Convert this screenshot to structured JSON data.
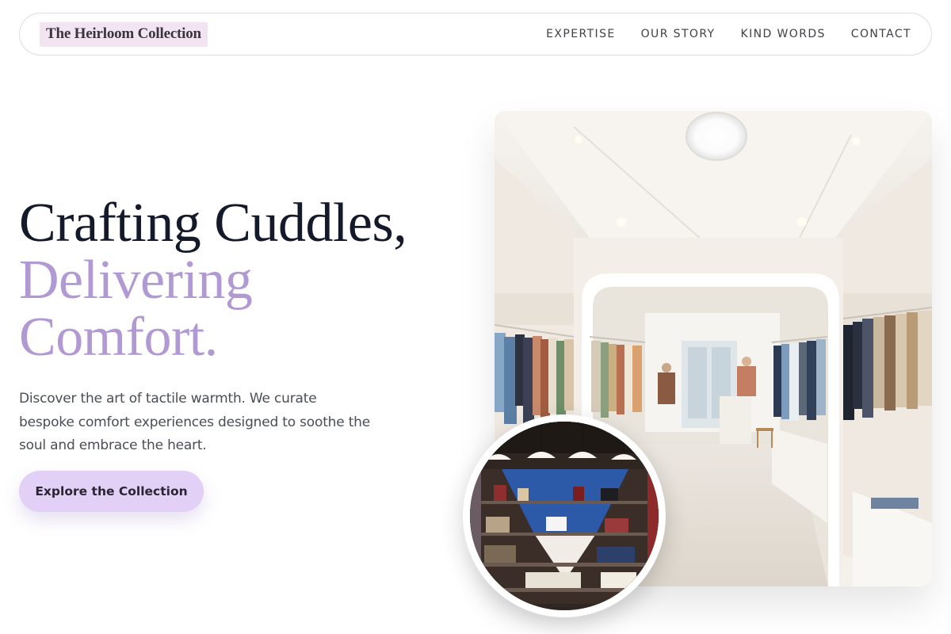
{
  "brand": {
    "name": "The Heirloom Collection"
  },
  "nav": {
    "items": [
      {
        "label": "EXPERTISE"
      },
      {
        "label": "OUR STORY"
      },
      {
        "label": "KIND WORDS"
      },
      {
        "label": "CONTACT"
      }
    ]
  },
  "hero": {
    "title_line1": "Crafting Cuddles,",
    "title_accent_line1": "Delivering",
    "title_accent_line2": "Comfort.",
    "description": "Discover the art of tactile warmth. We curate bespoke comfort experiences designed to soothe the soul and embrace the heart.",
    "cta_label": "Explore the Collection"
  },
  "colors": {
    "brand_highlight": "#f3e4f1",
    "title_dark": "#141a2a",
    "title_accent": "#b19ad3",
    "cta_background": "#e2d0f6"
  }
}
